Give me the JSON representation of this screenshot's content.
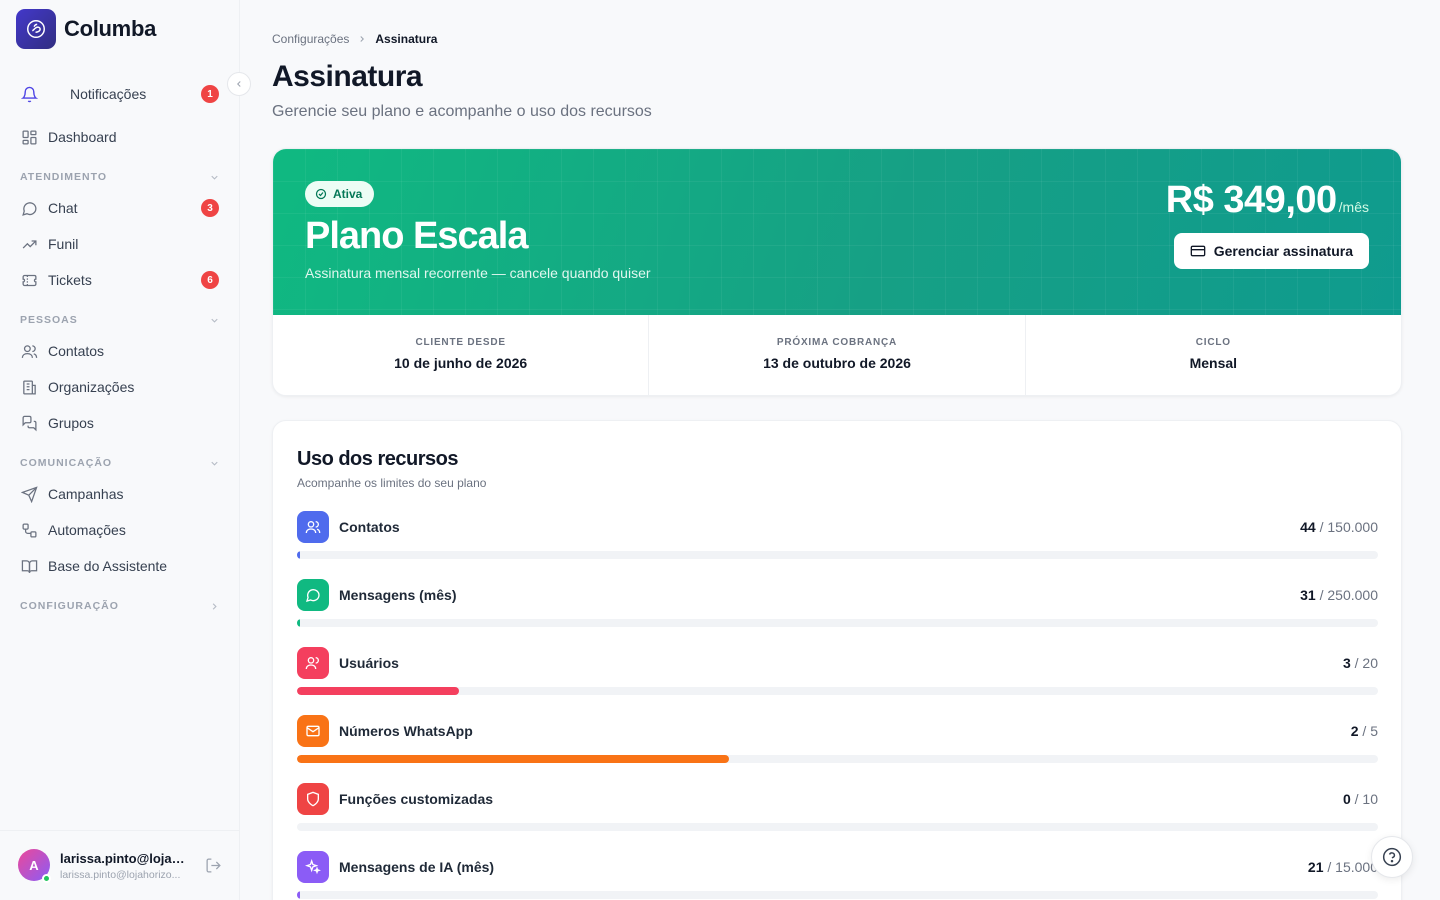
{
  "brand": {
    "name": "Columba"
  },
  "sidebar": {
    "notifications": {
      "label": "Notificações",
      "badge": "1"
    },
    "dashboard": {
      "label": "Dashboard"
    },
    "sections": [
      {
        "title": "ATENDIMENTO",
        "items": [
          {
            "label": "Chat",
            "badge": "3"
          },
          {
            "label": "Funil"
          },
          {
            "label": "Tickets",
            "badge": "6"
          }
        ]
      },
      {
        "title": "PESSOAS",
        "items": [
          {
            "label": "Contatos"
          },
          {
            "label": "Organizações"
          },
          {
            "label": "Grupos"
          }
        ]
      },
      {
        "title": "COMUNICAÇÃO",
        "items": [
          {
            "label": "Campanhas"
          },
          {
            "label": "Automações"
          },
          {
            "label": "Base do Assistente"
          }
        ]
      },
      {
        "title": "CONFIGURAÇÃO",
        "items": []
      }
    ],
    "user": {
      "initial": "A",
      "name": "larissa.pinto@lojah...",
      "email": "larissa.pinto@lojahorizo..."
    }
  },
  "breadcrumb": {
    "parent": "Configurações",
    "current": "Assinatura"
  },
  "page": {
    "title": "Assinatura",
    "subtitle": "Gerencie seu plano e acompanhe o uso dos recursos"
  },
  "plan": {
    "status": "Ativa",
    "name": "Plano Escala",
    "description": "Assinatura mensal recorrente — cancele quando quiser",
    "price": "R$ 349,00",
    "price_unit": "/mês",
    "manage_label": "Gerenciar assinatura",
    "stats": [
      {
        "label": "CLIENTE DESDE",
        "value": "10 de junho de 2026"
      },
      {
        "label": "PRÓXIMA COBRANÇA",
        "value": "13 de outubro de 2026"
      },
      {
        "label": "CICLO",
        "value": "Mensal"
      }
    ]
  },
  "usage": {
    "title": "Uso dos recursos",
    "subtitle": "Acompanhe os limites do seu plano",
    "resources": [
      {
        "name": "Contatos",
        "used": "44",
        "limit": "/ 150.000",
        "fraction": 0.0003,
        "color": "#4f6bed",
        "icon": "users-icon"
      },
      {
        "name": "Mensagens (mês)",
        "used": "31",
        "limit": "/ 250.000",
        "fraction": 0.0001,
        "color": "#10b981",
        "icon": "message-icon"
      },
      {
        "name": "Usuários",
        "used": "3",
        "limit": "/ 20",
        "fraction": 0.15,
        "color": "#f43f5e",
        "icon": "user-group-icon"
      },
      {
        "name": "Números WhatsApp",
        "used": "2",
        "limit": "/ 5",
        "fraction": 0.4,
        "color": "#f97316",
        "icon": "mail-icon"
      },
      {
        "name": "Funções customizadas",
        "used": "0",
        "limit": "/ 10",
        "fraction": 0,
        "color": "#ef4444",
        "icon": "shield-icon"
      },
      {
        "name": "Mensagens de IA (mês)",
        "used": "21",
        "limit": "/ 15.000",
        "fraction": 0.0014,
        "color": "#8b5cf6",
        "icon": "sparkles-icon"
      }
    ]
  }
}
